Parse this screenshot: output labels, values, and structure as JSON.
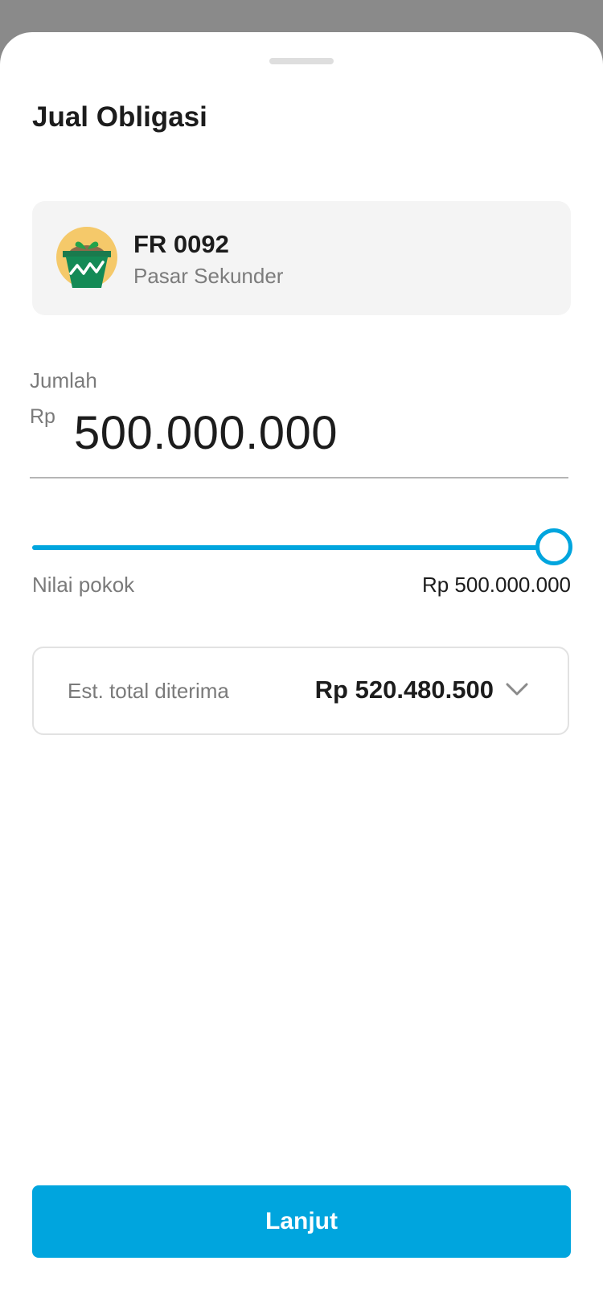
{
  "sheet": {
    "title": "Jual Obligasi"
  },
  "bond": {
    "code": "FR 0092",
    "market": "Pasar Sekunder",
    "icon": "plant-pot-chart-icon"
  },
  "amount": {
    "label": "Jumlah",
    "currency": "Rp",
    "value": "500.000.000"
  },
  "slider": {
    "fill_percent": 100,
    "left_label": "Nilai pokok",
    "right_value": "Rp 500.000.000"
  },
  "estimate": {
    "label": "Est. total diterima",
    "value": "Rp 520.480.500"
  },
  "cta": {
    "label": "Lanjut"
  },
  "colors": {
    "accent": "#00a5de",
    "overlay": "#8a8a8a"
  }
}
